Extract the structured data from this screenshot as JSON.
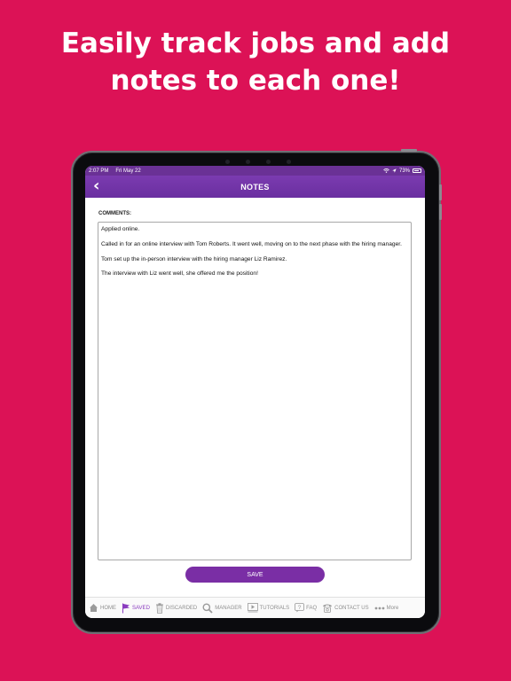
{
  "headline": {
    "line1": "Easily track jobs and add",
    "line2": "notes to each one!"
  },
  "statusbar": {
    "time": "2:07 PM",
    "date": "Fri May 22",
    "battery": "73%"
  },
  "navbar": {
    "back_icon": "chevron-left-icon",
    "title": "NOTES"
  },
  "comments": {
    "label": "COMMENTS:",
    "notes": [
      "Applied online.",
      "Called in for an online interview with Tom Roberts. It went well, moving on to the next phase with the hiring manager.",
      "Tom set up the in-person interview with the hiring manager Liz Ramirez.",
      "The interview with Liz went well, she offered me the position!"
    ]
  },
  "save_label": "SAVE",
  "tabs": [
    {
      "label": "HOME",
      "icon": "home-icon",
      "active": false
    },
    {
      "label": "SAVED",
      "icon": "flag-icon",
      "active": true
    },
    {
      "label": "DISCARDED",
      "icon": "trash-icon",
      "active": false
    },
    {
      "label": "MANAGER",
      "icon": "search-icon",
      "active": false
    },
    {
      "label": "TUTORIALS",
      "icon": "play-icon",
      "active": false
    },
    {
      "label": "FAQ",
      "icon": "question-icon",
      "active": false
    },
    {
      "label": "CONTACT US",
      "icon": "phone-icon",
      "active": false
    },
    {
      "label": "More",
      "icon": "more-icon",
      "active": false
    }
  ],
  "colors": {
    "background": "#dc1256",
    "brand_purple": "#7a2ea5",
    "active_tab": "#8a3cbf"
  }
}
